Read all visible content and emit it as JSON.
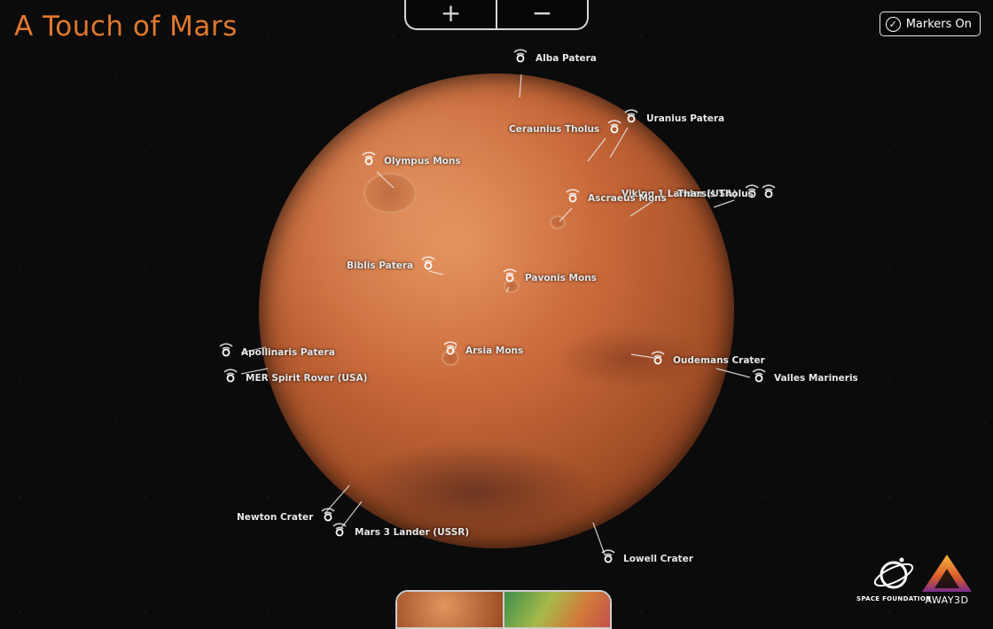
{
  "title": "A Touch of Mars",
  "zoom": {
    "in_label": "+",
    "out_label": "−"
  },
  "markers_toggle": {
    "label": "Markers On",
    "checked": true
  },
  "markers": [
    {
      "name": "Alba Patera"
    },
    {
      "name": "Uranius Patera"
    },
    {
      "name": "Ceraunius Tholus"
    },
    {
      "name": "Olympus Mons"
    },
    {
      "name": "Viking 1 Lander (USA)"
    },
    {
      "name": "Ascraeus Mons"
    },
    {
      "name": "Tharsis Tholus"
    },
    {
      "name": "Biblis Patera"
    },
    {
      "name": "Pavonis Mons"
    },
    {
      "name": "Apollinaris Patera"
    },
    {
      "name": "Arsia Mons"
    },
    {
      "name": "MER Spirit Rover (USA)"
    },
    {
      "name": "Oudemans Crater"
    },
    {
      "name": "Valles Marineris"
    },
    {
      "name": "Newton Crater"
    },
    {
      "name": "Mars 3 Lander (USSR)"
    },
    {
      "name": "Lowell Crater"
    }
  ],
  "map_thumbnails": [
    "mars-color-view",
    "topographic-view"
  ],
  "logos": {
    "space_foundation": "SPACE FOUNDATION",
    "away3d": "AWAY3D"
  }
}
